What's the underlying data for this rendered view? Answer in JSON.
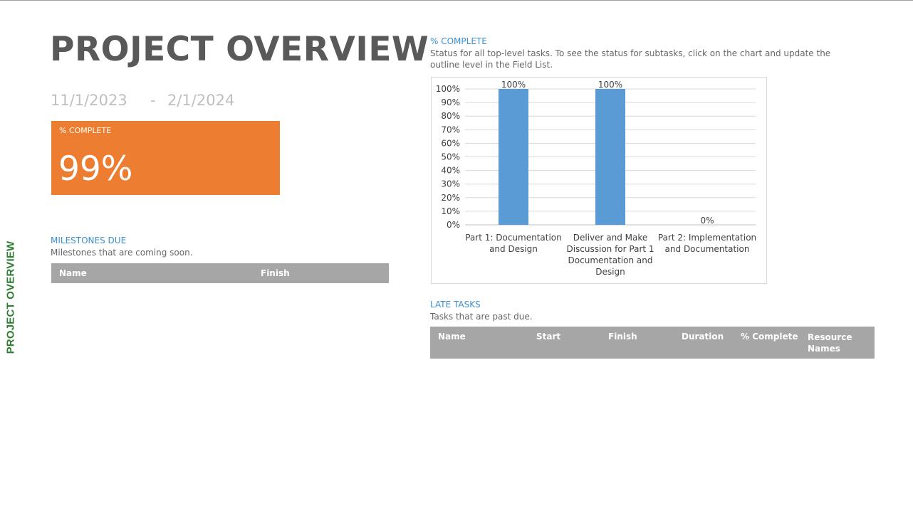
{
  "side_label": "PROJECT OVERVIEW",
  "title": "PROJECT OVERVIEW",
  "dates": {
    "start": "11/1/2023",
    "separator": "-",
    "finish": "2/1/2024"
  },
  "kpi": {
    "label": "% COMPLETE",
    "value": "99%",
    "color": "#ed7d31"
  },
  "milestones": {
    "title": "MILESTONES DUE",
    "subtitle": "Milestones that are coming soon.",
    "columns": [
      "Name",
      "Finish"
    ]
  },
  "complete_section": {
    "title": "% COMPLETE",
    "subtitle_line1": "Status for all top-level tasks. To see the status for subtasks, click on the chart and update the",
    "subtitle_line2": "outline level in the Field List."
  },
  "late_tasks": {
    "title": "LATE TASKS",
    "subtitle": "Tasks that are past due.",
    "columns": [
      "Name",
      "Start",
      "Finish",
      "Duration",
      "% Complete",
      "Resource Names"
    ]
  },
  "chart_data": {
    "type": "bar",
    "categories": [
      [
        "Part 1: Documentation",
        "and Design"
      ],
      [
        "Deliver and Make",
        "Discussion for Part 1",
        "Documentation and",
        "Design"
      ],
      [
        "Part 2: Implementation",
        "and Documentation"
      ]
    ],
    "values": [
      100,
      100,
      0
    ],
    "data_labels": [
      "100%",
      "100%",
      "0%"
    ],
    "ylim": [
      0,
      100
    ],
    "yticks": [
      "0%",
      "10%",
      "20%",
      "30%",
      "40%",
      "50%",
      "60%",
      "70%",
      "80%",
      "90%",
      "100%"
    ],
    "grid": true,
    "bar_color": "#5b9bd5"
  }
}
